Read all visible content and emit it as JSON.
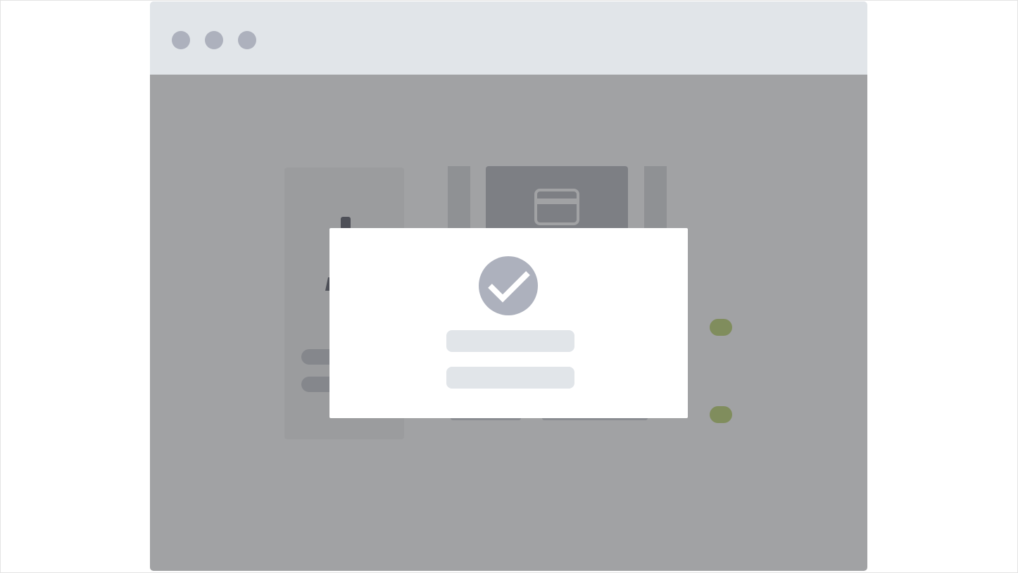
{
  "window": {
    "controls": [
      "close",
      "minimize",
      "maximize"
    ]
  },
  "background_page": {
    "profile_card": {
      "avatar_icon": "person-icon",
      "text_lines": 2
    },
    "payment_card": {
      "icon": "credit-card-icon"
    },
    "toggles": 2
  },
  "modal": {
    "icon": "check-circle-icon",
    "text_lines": 2
  },
  "colors": {
    "titlebar": "#e1e5e9",
    "traffic_light": "#adb1bd",
    "overlay": "rgba(64,66,70,0.49)",
    "modal_bg": "#ffffff",
    "check_circle": "#adb1bd",
    "placeholder": "#e1e5e9",
    "toggle_accent": "#bfd674"
  }
}
